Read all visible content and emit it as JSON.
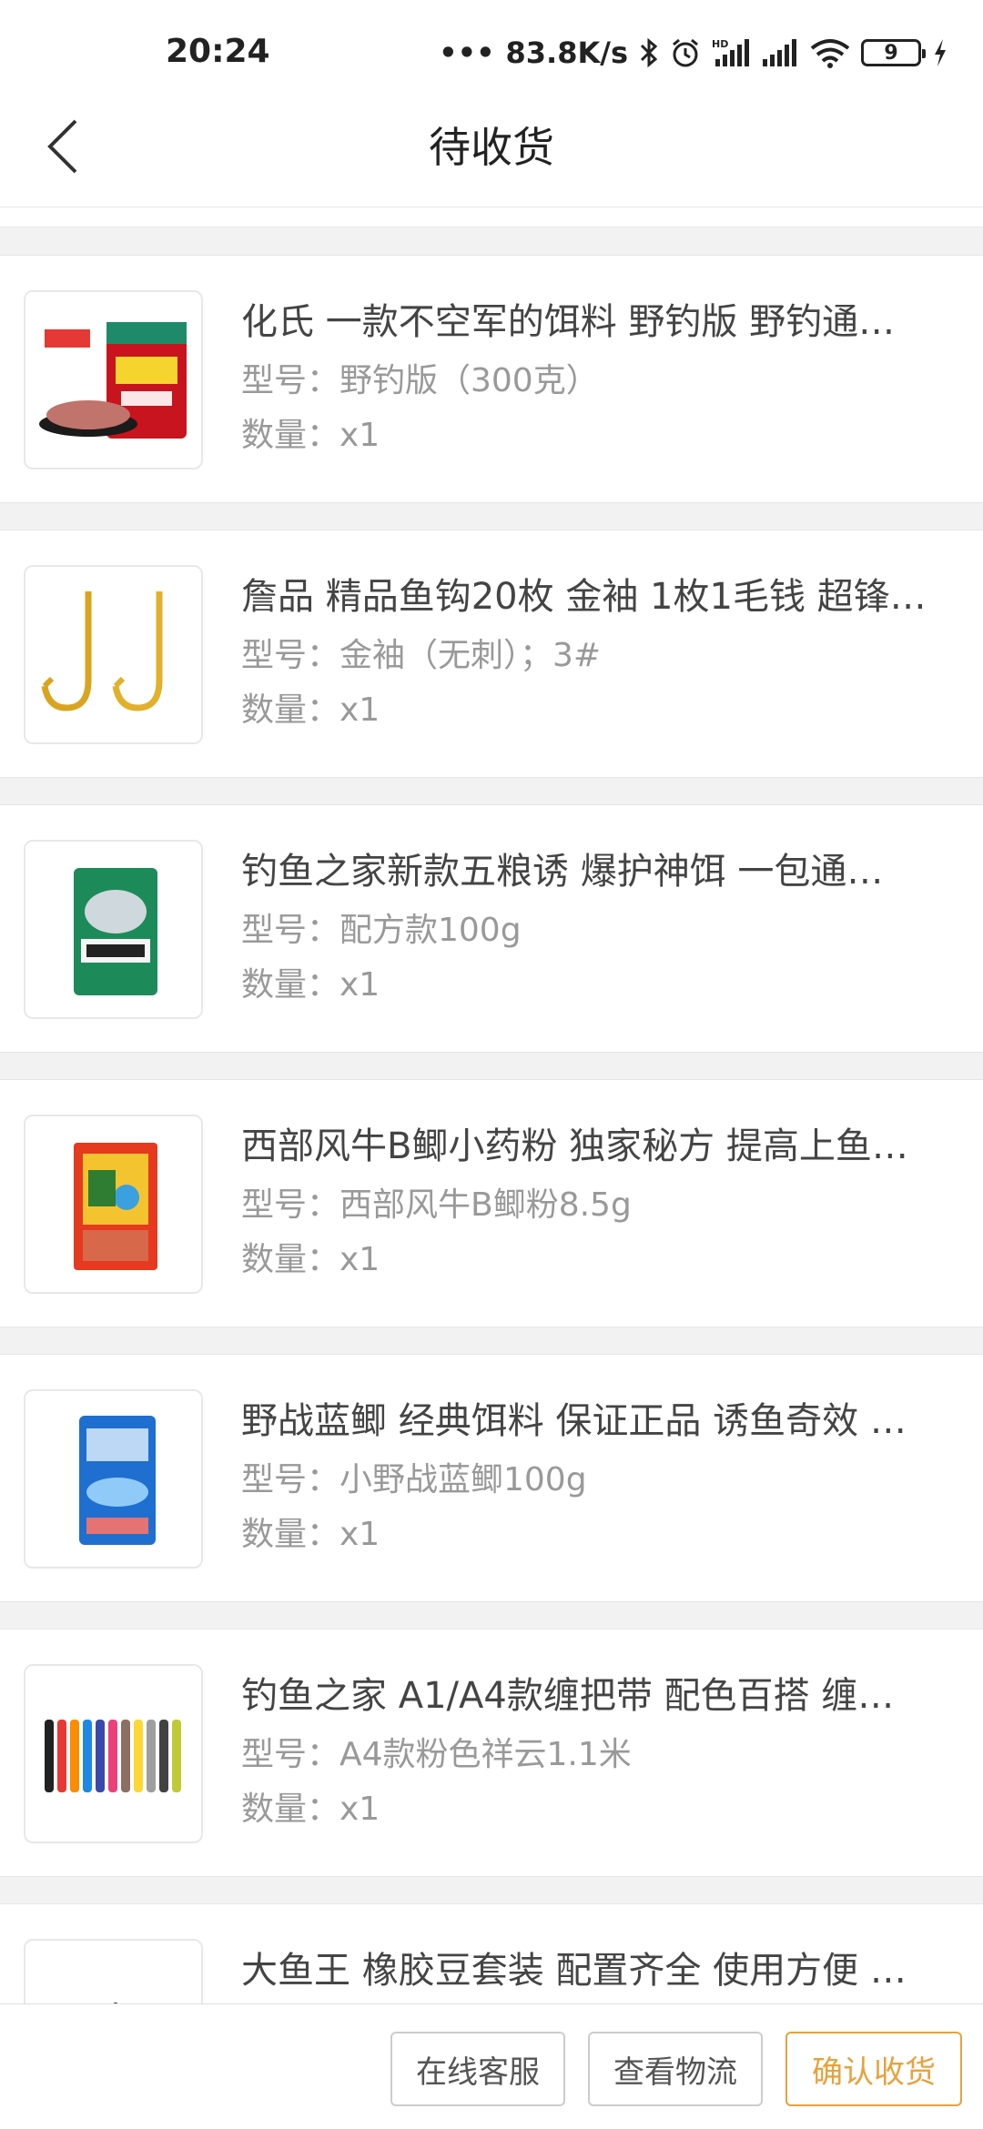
{
  "status_bar": {
    "time": "20:24",
    "network_speed": "83.8K/s",
    "battery_level": "9",
    "icons": [
      "bluetooth-icon",
      "alarm-icon",
      "hd-signal-icon",
      "signal-icon",
      "wifi-icon",
      "battery-icon",
      "charging-icon"
    ]
  },
  "header": {
    "title": "待收货",
    "back_icon": "chevron-left-icon"
  },
  "items": [
    {
      "title": "化氏 一款不空军的饵料 野钓版 野钓通…",
      "spec": "型号：野钓版（300克）",
      "qty": "数量：x1",
      "thumb": "bait-bag-red"
    },
    {
      "title": "詹品 精品鱼钩20枚 金袖 1枚1毛钱 超锋…",
      "spec": "型号：金袖（无刺）；3#",
      "qty": "数量：x1",
      "thumb": "gold-hooks"
    },
    {
      "title": "钓鱼之家新款五粮诱 爆护神饵 一包通…",
      "spec": "型号：配方款100g",
      "qty": "数量：x1",
      "thumb": "bait-bag-green"
    },
    {
      "title": "西部风牛B鲫小药粉 独家秘方 提高上鱼…",
      "spec": "型号：西部风牛B鲫粉8.5g",
      "qty": "数量：x1",
      "thumb": "bait-bag-orange"
    },
    {
      "title": "野战蓝鲫 经典饵料 保证正品 诱鱼奇效 …",
      "spec": "型号：小野战蓝鲫100g",
      "qty": "数量：x1",
      "thumb": "bait-bag-blue"
    },
    {
      "title": "钓鱼之家 A1/A4款缠把带 配色百搭 缠…",
      "spec": "型号：A4款粉色祥云1.1米",
      "qty": "数量：x1",
      "thumb": "grip-tapes"
    },
    {
      "title": "大鱼王 橡胶豆套装 配置齐全 使用方便 …",
      "spec": "",
      "qty": "",
      "thumb": "rubber-beads"
    }
  ],
  "actions": {
    "service": "在线客服",
    "logistics": "查看物流",
    "confirm": "确认收货"
  },
  "colors": {
    "accent": "#e6a23c",
    "page_bg": "#f2f2f2",
    "card_bg": "#ffffff"
  }
}
